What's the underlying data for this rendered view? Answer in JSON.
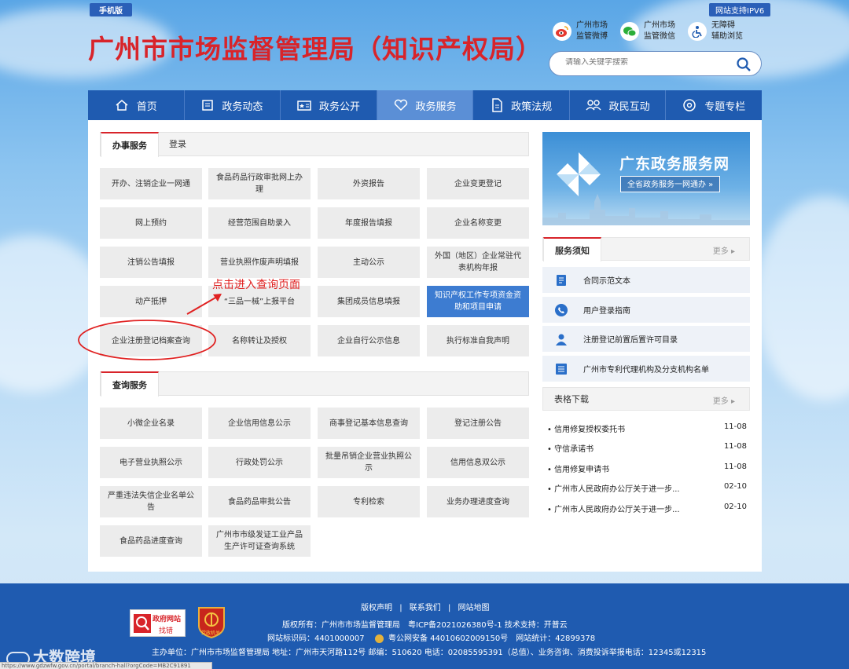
{
  "header": {
    "mobile_tag": "手机版",
    "ipv6_tag": "网站支持IPV6",
    "title": "广州市市场监督管理局（知识产权局）",
    "quick_links": [
      {
        "line1": "广州市场",
        "line2": "监管微博",
        "icon": "weibo-icon",
        "color": "#e6382e"
      },
      {
        "line1": "广州市场",
        "line2": "监管微信",
        "icon": "wechat-icon",
        "color": "#2aae3a"
      },
      {
        "line1": "无障碍",
        "line2": "辅助浏览",
        "icon": "accessibility-icon",
        "color": "#1f5bb0"
      }
    ],
    "search_placeholder": "请输入关键字搜索"
  },
  "nav": [
    {
      "label": "首页",
      "icon": "home-icon"
    },
    {
      "label": "政务动态",
      "icon": "news-icon"
    },
    {
      "label": "政务公开",
      "icon": "publicity-icon"
    },
    {
      "label": "政务服务",
      "icon": "heart-icon",
      "active": true
    },
    {
      "label": "政策法规",
      "icon": "document-icon"
    },
    {
      "label": "政民互动",
      "icon": "interaction-icon"
    },
    {
      "label": "专题专栏",
      "icon": "topic-icon"
    }
  ],
  "service_tabs": {
    "active": "办事服务",
    "other": "登录"
  },
  "service_buttons": [
    [
      "开办、注销企业一网通",
      "食品药品行政审批网上办理",
      "外资报告",
      "企业变更登记"
    ],
    [
      "网上预约",
      "经营范围自助录入",
      "年度报告填报",
      "企业名称变更"
    ],
    [
      "注销公告填报",
      "营业执照作废声明填报",
      "主动公示",
      "外国（地区）企业常驻代表机构年报"
    ],
    [
      "动产抵押",
      "“三品一械”上报平台",
      "集团成员信息填报",
      "知识产权工作专项资金资助和项目申请"
    ],
    [
      "企业注册登记档案查询",
      "名称转让及授权",
      "企业自行公示信息",
      "执行标准自我声明"
    ]
  ],
  "query_tab": "查询服务",
  "query_buttons": [
    [
      "小微企业名录",
      "企业信用信息公示",
      "商事登记基本信息查询",
      "登记注册公告"
    ],
    [
      "电子营业执照公示",
      "行政处罚公示",
      "批量吊销企业营业执照公示",
      "信用信息双公示"
    ],
    [
      "严重违法失信企业名单公告",
      "食品药品审批公告",
      "专利检索",
      "业务办理进度查询"
    ],
    [
      "食品药品进度查询",
      "广州市市级发证工业产品生产许可证查询系统"
    ]
  ],
  "annotation": "点击进入查询页面",
  "banner": {
    "title": "广东政务服务网",
    "subtitle": "全省政务服务一网通办 »"
  },
  "notices": {
    "title": "服务须知",
    "more": "更多",
    "items": [
      {
        "label": "合同示范文本",
        "icon": "contract-icon"
      },
      {
        "label": "用户登录指南",
        "icon": "phone-icon"
      },
      {
        "label": "注册登记前置后置许可目录",
        "icon": "user-icon"
      },
      {
        "label": "广州市专利代理机构及分支机构名单",
        "icon": "list-icon"
      }
    ]
  },
  "downloads": {
    "title": "表格下载",
    "more": "更多",
    "items": [
      {
        "title": "信用修复授权委托书",
        "date": "11-08"
      },
      {
        "title": "守信承诺书",
        "date": "11-08"
      },
      {
        "title": "信用修复申请书",
        "date": "11-08"
      },
      {
        "title": "广州市人民政府办公厅关于进一步...",
        "date": "02-10"
      },
      {
        "title": "广州市人民政府办公厅关于进一步...",
        "date": "02-10"
      }
    ]
  },
  "footer": {
    "links": [
      "版权声明",
      "联系我们",
      "网站地图"
    ],
    "line1": "版权所有：广州市市场监督管理局　粤ICP备2021026380号-1 技术支持：开普云",
    "line2_a": "网站标识码：4401000007",
    "line2_b": "粤公网安备 44010602009150号　网站统计：42899378",
    "line3": "主办单位：广州市市场监督管理局 地址：广州市天河路112号 邮编：510620 电话：02085595391（总值）、业务咨询、消费投诉举报电话：12345或12315",
    "badge1_top": "政府网站",
    "badge1_bottom": "找错",
    "badge2": "党政机关",
    "watermark": "大数跨境",
    "status_url": "https://www.gdzwfw.gov.cn/portal/branch-hall?orgCode=MB2C91891"
  }
}
